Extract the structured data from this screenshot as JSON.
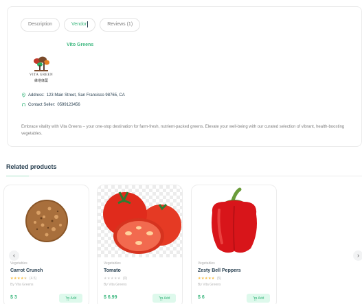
{
  "tabs": [
    {
      "label": "Description",
      "active": false
    },
    {
      "label": "Vendor",
      "active": true
    },
    {
      "label": "Reviews (1)",
      "active": false
    }
  ],
  "vendor": {
    "name": "Vito Greens",
    "logo_text": "VITA GREEN",
    "logo_subtext": "維塔綠葉",
    "address_label": "Address:",
    "address": "123 Main Street, San Francisco 98765, CA",
    "contact_label": "Contact Seller:",
    "contact": "0599123456",
    "description": "Embrace vitality with Vita Greens – your one-stop destination for farm-fresh, nutrient-packed greens. Elevate your well-being with our curated selection of vibrant, health-boosting vegetables."
  },
  "related": {
    "title": "Related products",
    "products": [
      {
        "category": "Vegetables",
        "name": "Carrot Crunch",
        "rating": 4.5,
        "rating_count": "(4.5)",
        "vendor": "By Vita Greens",
        "price": "$ 3",
        "add_label": "Add"
      },
      {
        "category": "Vegetables",
        "name": "Tomato",
        "rating": 0,
        "rating_count": "(0)",
        "vendor": "By Vita Greens",
        "price": "$ 6.99",
        "add_label": "Add"
      },
      {
        "category": "Vegetables",
        "name": "Zesty Bell Peppers",
        "rating": 5,
        "rating_count": "(5)",
        "vendor": "By Vita Greens",
        "price": "$ 6",
        "add_label": "Add"
      }
    ]
  },
  "icons": {
    "address": "location-pin-icon",
    "contact": "headset-icon",
    "cart": "cart-icon",
    "prev": "chevron-left-icon",
    "next": "chevron-right-icon"
  },
  "colors": {
    "brand": "#3bb77e",
    "star": "#fdc040",
    "add_bg": "#def9ec"
  }
}
